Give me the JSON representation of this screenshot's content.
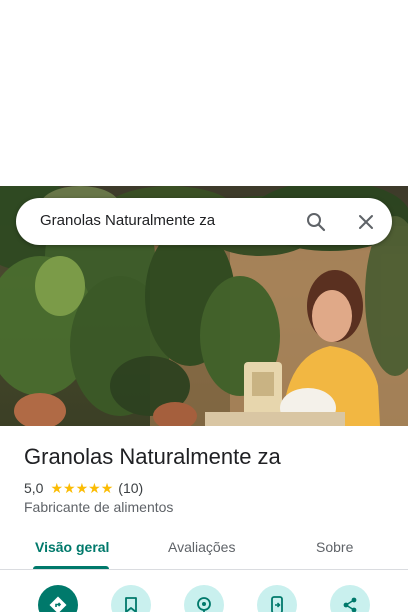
{
  "search": {
    "query": "Granolas Naturalmente za",
    "search_icon": "search-icon",
    "close_icon": "close-icon"
  },
  "place": {
    "name": "Granolas Naturalmente za",
    "rating": "5,0",
    "stars": 5,
    "review_count": "(10)",
    "category": "Fabricante de alimentos"
  },
  "tabs": [
    {
      "label": "Visão geral",
      "active": true
    },
    {
      "label": "Avaliações",
      "active": false
    },
    {
      "label": "Sobre",
      "active": false
    }
  ],
  "actions": [
    {
      "icon": "directions-icon",
      "primary": true
    },
    {
      "icon": "bookmark-icon",
      "primary": false
    },
    {
      "icon": "nearby-icon",
      "primary": false
    },
    {
      "icon": "send-to-phone-icon",
      "primary": false
    },
    {
      "icon": "share-icon",
      "primary": false
    }
  ],
  "colors": {
    "accent": "#00796b",
    "star": "#fbbc04",
    "action_bg": "#c9f0ee"
  }
}
